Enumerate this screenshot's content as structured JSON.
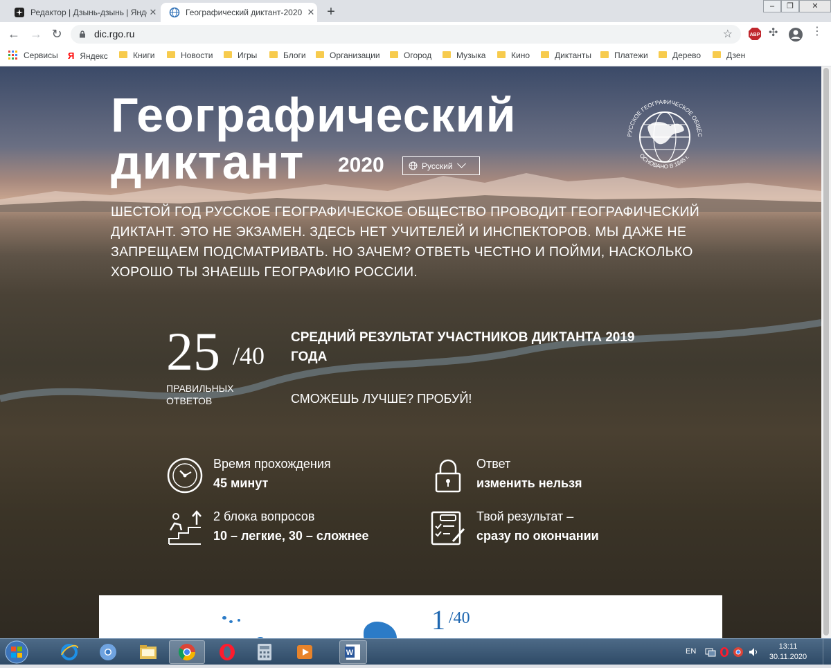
{
  "browser": {
    "tabs": [
      {
        "title": "Редактор | Дзынь-дзынь | Яндекс",
        "close": "✕"
      },
      {
        "title": "Географический диктант-2020 | ",
        "close": "✕"
      }
    ],
    "new_tab": "+",
    "url": "dic.rgo.ru",
    "bookmarks": [
      "Сервисы",
      "Яндекс",
      "Книги",
      "Новости",
      "Игры",
      "Блоги",
      "Организации",
      "Огород",
      "Музыка",
      "Кино",
      "Диктанты",
      "Платежи",
      "Дерево",
      "Дзен"
    ],
    "extension_abp": "ABP"
  },
  "hero": {
    "title_line1": "Географический",
    "title_line2": "диктант",
    "year": "2020",
    "language": "Русский",
    "logo_ring_text": "РУССКОЕ ГЕОГРАФИЧЕСКОЕ ОБЩЕСТВО",
    "logo_bottom_text": "ОСНОВАНО В 1845 г.",
    "lead": "ШЕСТОЙ ГОД РУССКОЕ ГЕОГРАФИЧЕСКОЕ ОБЩЕСТВО ПРОВОДИТ ГЕОГРАФИЧЕСКИЙ ДИКТАНТ. ЭТО НЕ ЭКЗАМЕН. ЗДЕСЬ НЕТ УЧИТЕЛЕЙ И ИНСПЕКТОРОВ. МЫ ДАЖЕ НЕ ЗАПРЕЩАЕМ ПОДСМАТРИВАТЬ. НО ЗАЧЕМ? ОТВЕТЬ ЧЕСТНО И ПОЙМИ, НАСКОЛЬКО ХОРОШО ТЫ ЗНАЕШЬ ГЕОГРАФИЮ РОССИИ."
  },
  "stats": {
    "score": "25",
    "score_of": "/40",
    "score_label": "ПРАВИЛЬНЫХ ОТВЕТОВ",
    "title": "СРЕДНИЙ РЕЗУЛЬТАТ УЧАСТНИКОВ ДИКТАНТА 2019 ГОДА",
    "challenge": "СМОЖЕШЬ ЛУЧШЕ? ПРОБУЙ!"
  },
  "features": [
    {
      "icon": "stopwatch-icon",
      "line1": "Время прохождения",
      "line2": "45 минут"
    },
    {
      "icon": "padlock-icon",
      "line1": "Ответ",
      "line2": "изменить нельзя"
    },
    {
      "icon": "stairs-icon",
      "line1": "2 блока вопросов",
      "line2": "10 – легкие, 30 – сложнее"
    },
    {
      "icon": "checklist-icon",
      "line1": "Твой результат –",
      "line2": "сразу по окончании"
    }
  ],
  "question_card": {
    "number": "1",
    "of": "/40"
  },
  "taskbar": {
    "apps": [
      "windows-explorer-icon",
      "internet-explorer-icon",
      "chromium-icon",
      "file-explorer-icon",
      "chrome-icon",
      "opera-icon",
      "calculator-icon",
      "video-player-icon",
      "word-icon"
    ],
    "lang": "EN",
    "time": "13:11",
    "date": "30.11.2020"
  },
  "colors": {
    "accent_blue": "#1d66b0",
    "tab_bar": "#dee1e6"
  }
}
